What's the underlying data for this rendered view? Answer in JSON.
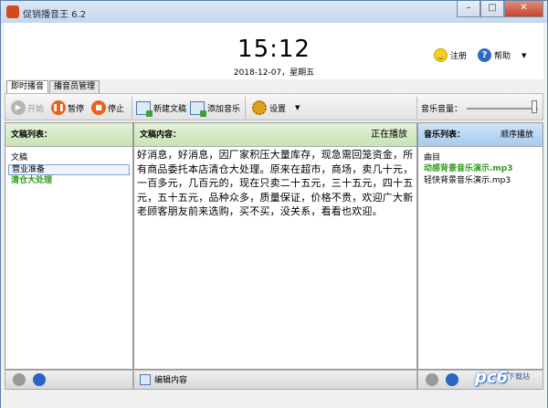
{
  "window": {
    "title": "促销播音王 6.2",
    "minimize": "–",
    "maximize": "□",
    "close": "✕"
  },
  "header": {
    "time": "15:12",
    "date": "2018-12-07，星期五",
    "register_label": "注册",
    "help_label": "帮助",
    "help_caret": "▼",
    "help_glyph": "?"
  },
  "tabs": [
    {
      "label": "即时播音"
    },
    {
      "label": "播音员管理"
    }
  ],
  "toolbar": {
    "start_label": "开始",
    "pause_label": "暂停",
    "stop_label": "停止",
    "new_doc_label": "新建文稿",
    "add_music_label": "添加音乐",
    "settings_label": "设置",
    "settings_caret": "▼",
    "music_volume_label": "音乐音量：",
    "music_volume": 0.95
  },
  "doc_list": {
    "header": "文稿列表：",
    "column": "文稿",
    "items": [
      {
        "label": "营业准备"
      },
      {
        "label": "清仓大处理"
      }
    ]
  },
  "doc_content": {
    "header": "文稿内容：",
    "status": "正在播放",
    "text": "好消息，好消息，因厂家积压大量库存，现急需回笼资金，所有商品委托本店清仓大处理。原来在超市，商场，卖几十元，一百多元，几百元的，现在只卖二十五元，三十五元，四十五元，五十五元，品种众多，质量保证，价格不贵，欢迎广大新老顾客朋友前来选购，买不买，没关系，看看也欢迎。"
  },
  "music_list": {
    "header": "音乐列表：",
    "mode": "顺序播放",
    "column": "曲目",
    "items": [
      {
        "label": "动感背景音乐演示.mp3"
      },
      {
        "label": "轻快背景音乐演示.mp3"
      }
    ]
  },
  "bottom": {
    "edit_label": "编辑内容"
  },
  "watermark": {
    "text": "pc6",
    "sub": "下载站"
  }
}
